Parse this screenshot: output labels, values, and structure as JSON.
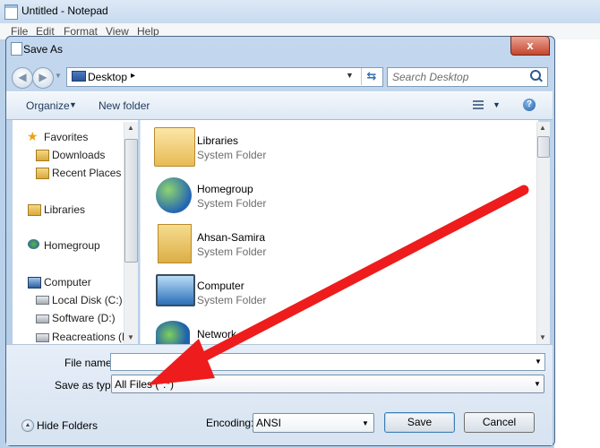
{
  "notepad": {
    "title": "Untitled - Notepad",
    "menu": [
      "File",
      "Edit",
      "Format",
      "View",
      "Help"
    ]
  },
  "dialog": {
    "title": "Save As",
    "close_label": "x"
  },
  "address_bar": {
    "location": "Desktop",
    "separator": "▸",
    "search_placeholder": "Search Desktop"
  },
  "toolbar": {
    "organize_label": "Organize",
    "new_folder_label": "New folder",
    "help_label": "?"
  },
  "nav_pane": {
    "items": [
      {
        "label": "Favorites",
        "icon": "star-icon"
      },
      {
        "label": "Downloads",
        "icon": "downloads-folder-icon"
      },
      {
        "label": "Recent Places",
        "icon": "recent-places-icon"
      },
      {
        "label": "Libraries",
        "icon": "libraries-icon"
      },
      {
        "label": "Homegroup",
        "icon": "homegroup-icon"
      },
      {
        "label": "Computer",
        "icon": "computer-icon"
      },
      {
        "label": "Local Disk (C:)",
        "icon": "drive-icon"
      },
      {
        "label": "Software (D:)",
        "icon": "drive-icon"
      },
      {
        "label": "Reacreations (E:)",
        "icon": "drive-icon"
      }
    ]
  },
  "files": [
    {
      "name": "Libraries",
      "type": "System Folder",
      "icon": "libraries-icon"
    },
    {
      "name": "Homegroup",
      "type": "System Folder",
      "icon": "homegroup-icon"
    },
    {
      "name": "Ahsan-Samira",
      "type": "System Folder",
      "icon": "user-folder-icon"
    },
    {
      "name": "Computer",
      "type": "System Folder",
      "icon": "computer-icon"
    },
    {
      "name": "Network",
      "type": "",
      "icon": "network-icon"
    }
  ],
  "form": {
    "file_name_label": "File name:",
    "file_name_value": "",
    "save_as_type_label": "Save as type:",
    "save_as_type_value": "All Files  (*.*)",
    "hide_folders_label": "Hide Folders",
    "encoding_label": "Encoding:",
    "encoding_value": "ANSI",
    "save_label": "Save",
    "cancel_label": "Cancel"
  },
  "colors": {
    "annotation_arrow": "#ee1c1c",
    "dialog_frame": "#b3cbe6",
    "link_text": "#1e395b"
  }
}
